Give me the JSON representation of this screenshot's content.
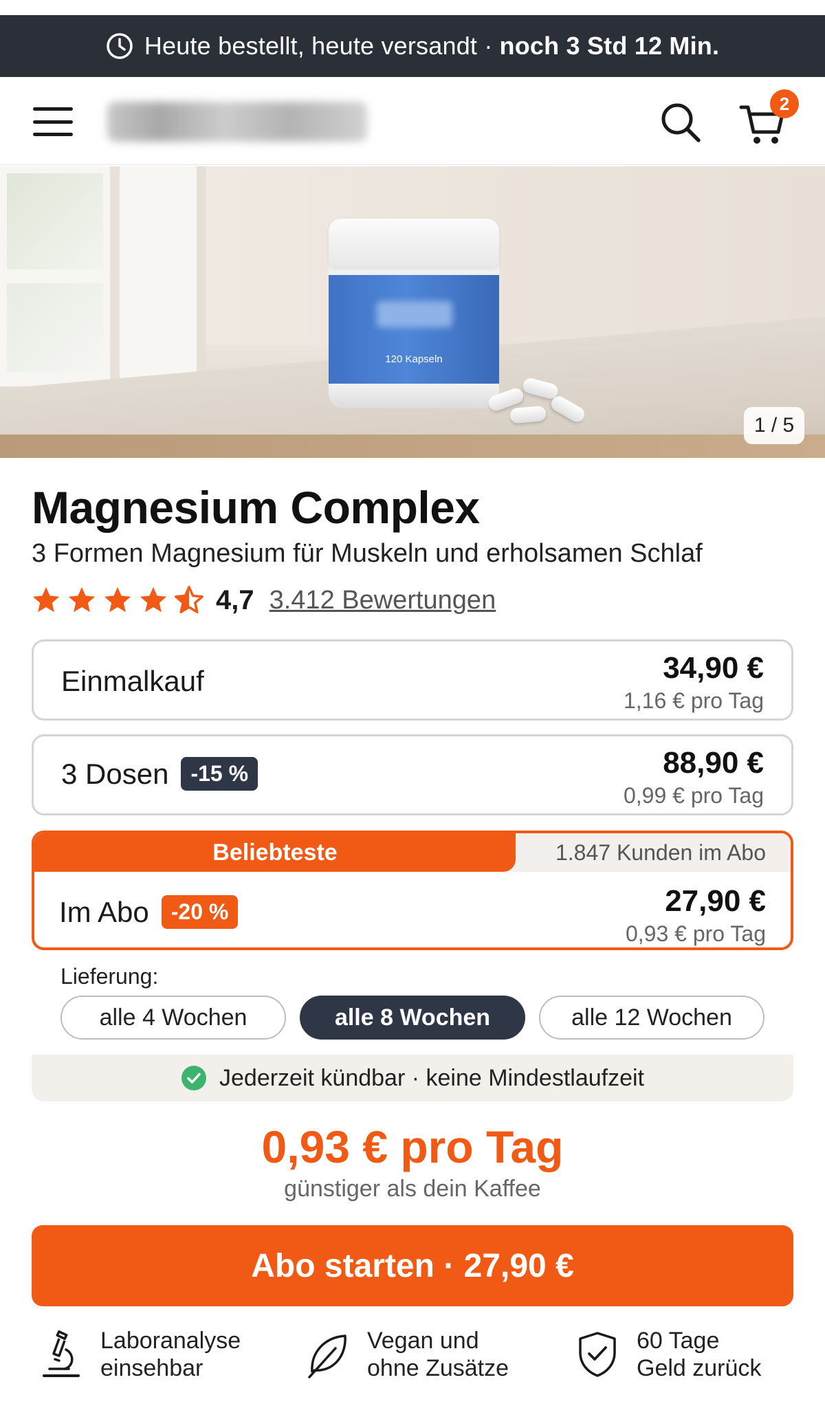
{
  "announcement": {
    "text": "Heute bestellt, heute versandt ·",
    "highlight": "noch 3 Std 12 Min."
  },
  "header": {
    "cart_count": "2"
  },
  "gallery": {
    "jar_label": "120 Kapseln",
    "counter": "1 / 5"
  },
  "product": {
    "title": "Magnesium Complex",
    "subtitle": "3 Formen Magnesium für Muskeln und erholsamen Schlaf",
    "rating": "4,7",
    "rating_stars": 4.5,
    "reviews": "3.412 Bewertungen"
  },
  "options": {
    "single": {
      "label": "Einmalkauf",
      "price": "34,90 €",
      "per_day": "1,16 € pro Tag"
    },
    "three": {
      "label": "3 Dosen",
      "badge": "-15 %",
      "price": "88,90 €",
      "per_day": "0,99 € pro Tag"
    },
    "abo": {
      "ribbon": "Beliebteste",
      "customers": "1.847 Kunden im Abo",
      "label": "Im Abo",
      "badge": "-20 %",
      "price": "27,90 €",
      "per_day": "0,93 € pro Tag"
    }
  },
  "delivery": {
    "label": "Lieferung:",
    "intervals": [
      "alle 4 Wochen",
      "alle 8 Wochen",
      "alle 12 Wochen"
    ],
    "selected": "alle 8 Wochen",
    "note": "Jederzeit kündbar · keine Mindestlaufzeit"
  },
  "summary": {
    "per_day": "0,93 € pro Tag",
    "compare": "günstiger als dein Kaffee"
  },
  "cta": {
    "label": "Abo starten · 27,90 €"
  },
  "features": [
    {
      "icon": "microscope-icon",
      "line1": "Laboranalyse",
      "line2": "einsehbar"
    },
    {
      "icon": "leaf-icon",
      "line1": "Vegan und",
      "line2": "ohne Zusätze"
    },
    {
      "icon": "shield-check-icon",
      "line1": "60 Tage",
      "line2": "Geld zurück"
    }
  ],
  "colors": {
    "accent": "#f05a14",
    "dark": "#2f3645",
    "topbar": "#2b2f38",
    "success": "#3cb46e"
  }
}
